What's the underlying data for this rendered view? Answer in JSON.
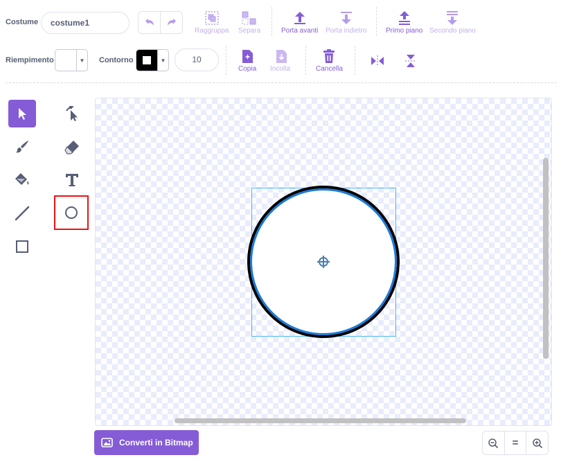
{
  "costume": {
    "label": "Costume",
    "name": "costume1"
  },
  "toolbar": {
    "group_label": "Raggruppa",
    "ungroup_label": "Separa",
    "forward_label": "Porta avanti",
    "backward_label": "Porta indietro",
    "front_label": "Primo piano",
    "back_label": "Secondo piano",
    "fill_label": "Riempimento",
    "outline_label": "Contorno",
    "outline_width": "10",
    "copy_label": "Copia",
    "paste_label": "Incolla",
    "delete_label": "Cancella"
  },
  "tools": [
    {
      "name": "select",
      "icon": "arrow-cursor-icon",
      "selected": true
    },
    {
      "name": "reshape",
      "icon": "reshape-cursor-icon",
      "selected": false
    },
    {
      "name": "brush",
      "icon": "brush-icon",
      "selected": false
    },
    {
      "name": "eraser",
      "icon": "eraser-icon",
      "selected": false
    },
    {
      "name": "fill",
      "icon": "paint-bucket-icon",
      "selected": false
    },
    {
      "name": "text",
      "icon": "text-icon",
      "selected": false
    },
    {
      "name": "line",
      "icon": "line-icon",
      "selected": false
    },
    {
      "name": "circle",
      "icon": "circle-icon",
      "selected": false,
      "highlighted": true
    },
    {
      "name": "rectangle",
      "icon": "rectangle-icon",
      "selected": false
    }
  ],
  "bottom": {
    "convert_label": "Converti in Bitmap",
    "zoom_reset_label": "="
  },
  "colors": {
    "accent": "#855cd6",
    "selection": "#4c97ff",
    "highlight": "#ee1111",
    "text": "#575e75"
  }
}
